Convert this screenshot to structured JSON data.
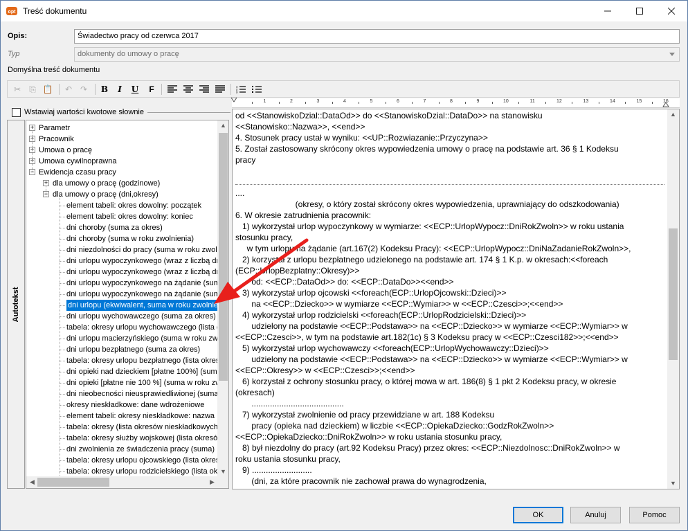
{
  "window": {
    "title": "Treść dokumentu"
  },
  "form": {
    "opis_label": "Opis:",
    "opis_value": "Świadectwo pracy od czerwca 2017",
    "typ_label": "Typ",
    "typ_value": "dokumenty do umowy o pracę",
    "default_content_label": "Domyślna treść dokumentu"
  },
  "toolbar": {
    "cut": "✂",
    "copy": "⎘",
    "paste": "📋",
    "undo": "↶",
    "redo": "↷",
    "bold": "B",
    "italic": "I",
    "underline": "U",
    "font": "F"
  },
  "checkbox": {
    "label": "Wstawiaj wartości kwotowe słownie",
    "checked": false
  },
  "autotext": {
    "tab_label": "Autotekst",
    "tree": [
      {
        "label": "Parametr",
        "level": 0,
        "expander": "+"
      },
      {
        "label": "Pracownik",
        "level": 0,
        "expander": "+"
      },
      {
        "label": "Umowa o pracę",
        "level": 0,
        "expander": "+"
      },
      {
        "label": "Umowa cywilnoprawna",
        "level": 0,
        "expander": "+"
      },
      {
        "label": "Ewidencja czasu pracy",
        "level": 0,
        "expander": "−"
      },
      {
        "label": "dla umowy o pracę (godzinowe)",
        "level": 1,
        "expander": "+"
      },
      {
        "label": "dla umowy o pracę (dni,okresy)",
        "level": 1,
        "expander": "−"
      },
      {
        "label": "element tabeli: okres dowolny: początek",
        "level": 2
      },
      {
        "label": "element tabeli: okres dowolny: koniec",
        "level": 2
      },
      {
        "label": "dni choroby (suma za okres)",
        "level": 2
      },
      {
        "label": "dni choroby (suma w roku zwolnienia)",
        "level": 2
      },
      {
        "label": "dni niezdolności do pracy (suma w roku zwolni",
        "level": 2
      },
      {
        "label": "dni urlopu wypoczynkowego (wraz z liczbą dn",
        "level": 2
      },
      {
        "label": "dni urlopu wypoczynkowego (wraz z liczbą dn",
        "level": 2
      },
      {
        "label": "dni urlopu wypoczynkowego na żądanie (suma",
        "level": 2
      },
      {
        "label": "dni urlopu wypoczynkowego na żądanie (suma",
        "level": 2
      },
      {
        "label": "dni urlopu (ekwiwalent, suma w roku zwolnien",
        "level": 2,
        "selected": true
      },
      {
        "label": "dni urlopu wychowawczego (suma za okres)",
        "level": 2
      },
      {
        "label": "tabela: okresy urlopu wychowawczego (lista c",
        "level": 2
      },
      {
        "label": "dni urlopu macierzyńskiego (suma w roku zwol",
        "level": 2
      },
      {
        "label": "dni urlopu bezpłatnego (suma za okres)",
        "level": 2
      },
      {
        "label": "tabela: okresy urlopu bezpłatnego (lista okres",
        "level": 2
      },
      {
        "label": "dni opieki nad dzieckiem [płatne 100%] (sumo",
        "level": 2
      },
      {
        "label": "dni opieki [płatne nie 100 %] (suma w roku zw",
        "level": 2
      },
      {
        "label": "dni nieobecności nieusprawiedliwionej (suma",
        "level": 2
      },
      {
        "label": "okresy nieskładkowe: dane wdrożeniowe",
        "level": 2
      },
      {
        "label": "element tabeli: okresy nieskładkowe: nazwa",
        "level": 2
      },
      {
        "label": "tabela: okresy (lista okresów nieskładkowych",
        "level": 2
      },
      {
        "label": "tabela: okresy służby wojskowej (lista okresó",
        "level": 2
      },
      {
        "label": "dni zwolnienia ze świadczenia pracy (suma)",
        "level": 2
      },
      {
        "label": "tabela: okresy urlopu ojcowskiego (lista okres",
        "level": 2
      },
      {
        "label": "tabela: okresy urlopu rodzicielskiego (lista oki",
        "level": 2
      }
    ]
  },
  "ruler": {
    "numbers": [
      "1",
      "2",
      "3",
      "4",
      "5",
      "6",
      "7",
      "8",
      "9",
      "10",
      "11",
      "12",
      "13",
      "14",
      "15",
      "16"
    ]
  },
  "editor": {
    "lines": [
      "od <<StanowiskoDzial::DataOd>> do <<StanowiskoDzial::DataDo>> na stanowisku",
      "<<Stanowisko::Nazwa>>, <<end>>",
      "4. Stosunek pracy ustał w wyniku: <<UP::Rozwiazanie::Przyczyna>>",
      "5. Został zastosowany skrócony okres wypowiedzenia umowy o pracę na podstawie art. 36 § 1 Kodeksu",
      "pracy",
      "",
      "",
      "....",
      "                          (okresy, o który został skrócony okres wypowiedzenia, uprawniający do odszkodowania)",
      "6. W okresie zatrudnienia pracownik:",
      "   1) wykorzystał urlop wypoczynkowy w wymiarze: <<ECP::UrlopWypocz::DniRokZwoln>> w roku ustania",
      "stosunku pracy,",
      "     w tym urlopu na żądanie (art.167(2) Kodeksu Pracy): <<ECP::UrlopWypocz::DniNaZadanieRokZwoln>>,",
      "   2) korzystał z urlopu bezpłatnego udzielonego na podstawie art. 174 § 1 K.p. w okresach:<<foreach",
      "(ECP::UrlopBezplatny::Okresy)>>",
      "       od: <<ECP::DataOd>> do: <<ECP::DataDo>><<end>>",
      "   3) wykorzystał urlop ojcowski <<foreach(ECP::UrlopOjcowski::Dzieci)>>",
      "       na <<ECP::Dziecko>> w wymiarze <<ECP::Wymiar>> w <<ECP::Czesci>>;<<end>>",
      "   4) wykorzystał urlop rodzicielski <<foreach(ECP::UrlopRodzicielski::Dzieci)>>",
      "       udzielony na podstawie <<ECP::Podstawa>> na <<ECP::Dziecko>> w wymiarze <<ECP::Wymiar>> w",
      "<<ECP::Czesci>>, w tym na podstawie art.182(1c) § 3 Kodeksu pracy w <<ECP::Czesci182>>;<<end>>",
      "   5) wykorzystał urlop wychowawczy <<foreach(ECP::UrlopWychowawczy::Dzieci)>>",
      "       udzielony na podstawie <<ECP::Podstawa>> na <<ECP::Dziecko>> w wymiarze <<ECP::Wymiar>> w",
      "<<ECP::Okresy>> w <<ECP::Czesci>>;<<end>>",
      "   6) korzystał z ochrony stosunku pracy, o której mowa w art. 186(8) § 1 pkt 2 Kodeksu pracy, w okresie",
      "(okresach)",
      "       ........................................",
      "   7) wykorzystał zwolnienie od pracy przewidziane w art. 188 Kodeksu",
      "       pracy (opieka nad dzieckiem) w liczbie <<ECP::OpiekaDziecko::GodzRokZwoln>>",
      "<<ECP::OpiekaDziecko::DniRokZwoln>> w roku ustania stosunku pracy,",
      "   8) był niezdolny do pracy (art.92 Kodeksu Pracy) przez okres: <<ECP::Niezdolnosc::DniRokZwoln>> w",
      "roku ustania stosunku pracy,",
      "   9) ..........................",
      "       (dni, za które pracownik nie zachował prawa do wynagrodzenia,"
    ]
  },
  "buttons": {
    "ok": "OK",
    "cancel": "Anuluj",
    "help": "Pomoc"
  }
}
